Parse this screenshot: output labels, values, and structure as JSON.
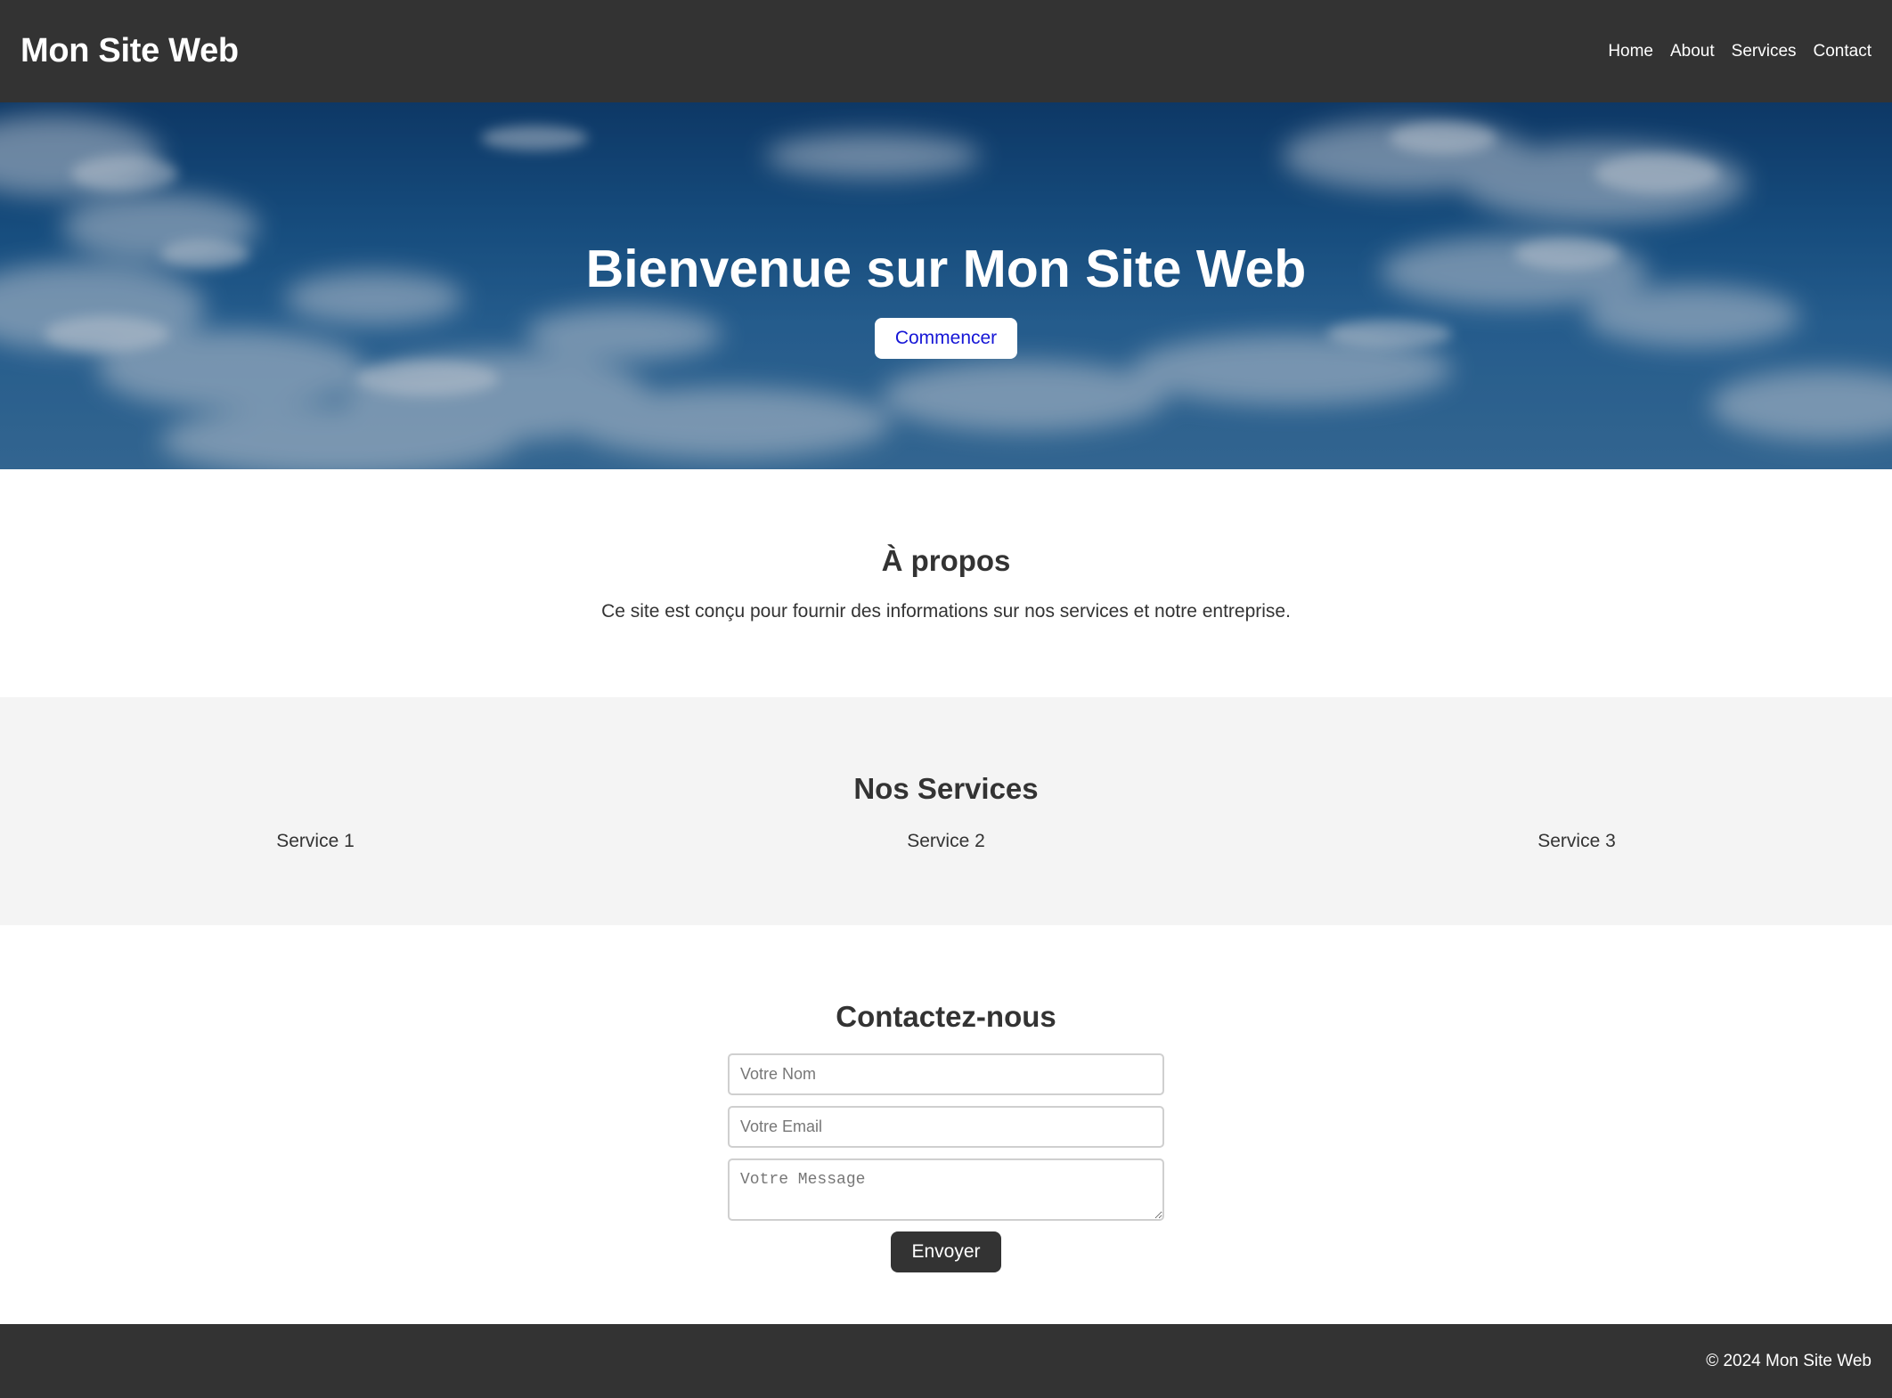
{
  "header": {
    "logo": "Mon Site Web",
    "nav": [
      "Home",
      "About",
      "Services",
      "Contact"
    ]
  },
  "hero": {
    "title": "Bienvenue sur Mon Site Web",
    "button_label": "Commencer"
  },
  "about": {
    "title": "À propos",
    "text": "Ce site est conçu pour fournir des informations sur nos services et notre entreprise."
  },
  "services": {
    "title": "Nos Services",
    "items": [
      "Service 1",
      "Service 2",
      "Service 3"
    ]
  },
  "contact": {
    "title": "Contactez-nous",
    "name_placeholder": "Votre Nom",
    "email_placeholder": "Votre Email",
    "message_placeholder": "Votre Message",
    "submit_label": "Envoyer"
  },
  "footer": {
    "text": "© 2024 Mon Site Web"
  },
  "colors": {
    "header_bg": "#333333",
    "section_alt_bg": "#f4f4f4",
    "hero_button_text": "#1515d6"
  }
}
